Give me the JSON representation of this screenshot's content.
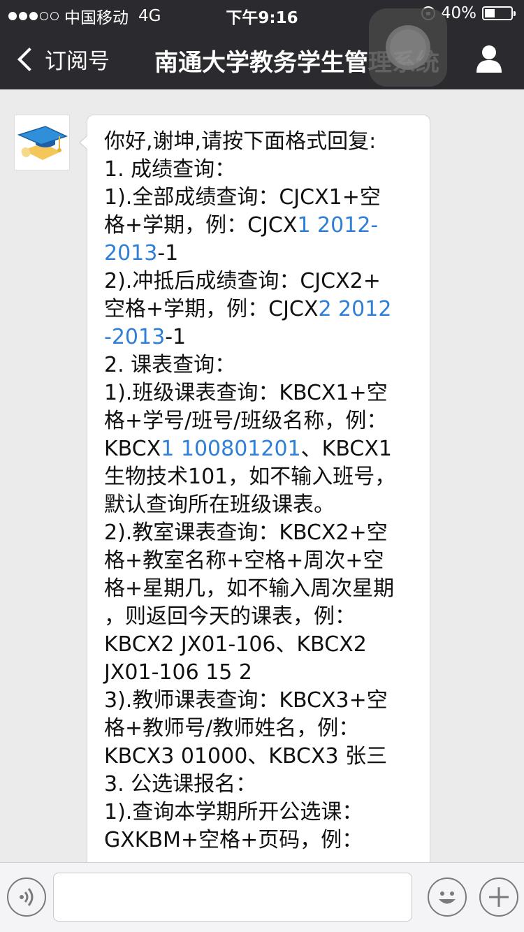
{
  "status_bar": {
    "carrier": "中国移动",
    "network": "4G",
    "time": "下午9:16",
    "battery_percent": "40%",
    "battery_level": 0.4,
    "signal_filled": 3,
    "signal_total": 5
  },
  "nav": {
    "back_label": "订阅号",
    "title": "南通大学教务学生管理系统"
  },
  "message": {
    "lines": [
      [
        {
          "t": "你好,谢坤,请按下面格式回复:"
        }
      ],
      [
        {
          "t": "1. 成绩查询："
        }
      ],
      [
        {
          "t": "1).全部成绩查询：CJCX1+空"
        }
      ],
      [
        {
          "t": "格+学期，例：CJCX"
        },
        {
          "t": "1 2012-",
          "link": true
        }
      ],
      [
        {
          "t": "2013",
          "link": true
        },
        {
          "t": "-1"
        }
      ],
      [
        {
          "t": "2).冲抵后成绩查询：CJCX2+"
        }
      ],
      [
        {
          "t": "空格+学期，例：CJCX"
        },
        {
          "t": "2 2012",
          "link": true
        }
      ],
      [
        {
          "t": "-2013",
          "link": true
        },
        {
          "t": "-1"
        }
      ],
      [
        {
          "t": "2. 课表查询："
        }
      ],
      [
        {
          "t": "1).班级课表查询：KBCX1+空"
        }
      ],
      [
        {
          "t": "格+学号/班号/班级名称，例："
        }
      ],
      [
        {
          "t": "KBCX"
        },
        {
          "t": "1 100801201",
          "link": true
        },
        {
          "t": "、KBCX1"
        }
      ],
      [
        {
          "t": "生物技术101，如不输入班号，"
        }
      ],
      [
        {
          "t": "默认查询所在班级课表。"
        }
      ],
      [
        {
          "t": "2).教室课表查询：KBCX2+空"
        }
      ],
      [
        {
          "t": "格+教室名称+空格+周次+空"
        }
      ],
      [
        {
          "t": "格+星期几，如不输入周次星期"
        }
      ],
      [
        {
          "t": "，则返回今天的课表，例："
        }
      ],
      [
        {
          "t": "KBCX2 JX01-106、KBCX2"
        }
      ],
      [
        {
          "t": "JX01-106 15 2"
        }
      ],
      [
        {
          "t": "3).教师课表查询：KBCX3+空"
        }
      ],
      [
        {
          "t": "格+教师号/教师姓名，例："
        }
      ],
      [
        {
          "t": "KBCX3 01000、KBCX3 张三"
        }
      ],
      [
        {
          "t": "3. 公选课报名："
        }
      ],
      [
        {
          "t": "1).查询本学期所开公选课："
        }
      ],
      [
        {
          "t": "GXKBM+空格+页码，例："
        }
      ]
    ]
  },
  "colors": {
    "topbar": "#2b2b2f",
    "chat_bg": "#ebebeb",
    "link": "#2f7fd6"
  },
  "icons": {
    "back": "chevron-left-icon",
    "profile": "person-icon",
    "avatar": "graduation-cap-icon",
    "voice": "voice-icon",
    "emoji": "smile-icon",
    "more": "plus-icon"
  },
  "input": {
    "value": ""
  }
}
